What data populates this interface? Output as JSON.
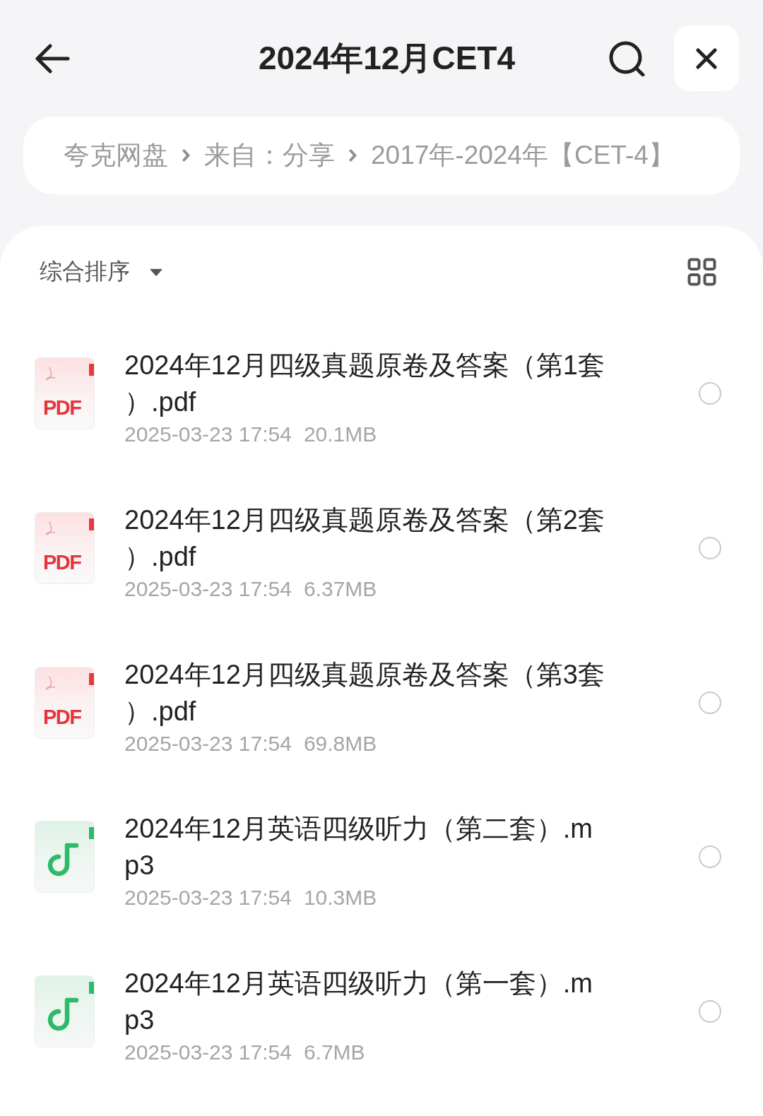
{
  "header": {
    "title": "2024年12月CET4"
  },
  "breadcrumb": [
    "夸克网盘",
    "来自：分享",
    "2017年-2024年【CET-4】"
  ],
  "sort": {
    "label": "综合排序"
  },
  "files": [
    {
      "kind": "pdf",
      "icon_label": "PDF",
      "name": "2024年12月四级真题原卷及答案（第1套）.pdf",
      "date": "2025-03-23 17:54",
      "size": "20.1MB",
      "selected": false
    },
    {
      "kind": "pdf",
      "icon_label": "PDF",
      "name": "2024年12月四级真题原卷及答案（第2套）.pdf",
      "date": "2025-03-23 17:54",
      "size": "6.37MB",
      "selected": false
    },
    {
      "kind": "pdf",
      "icon_label": "PDF",
      "name": "2024年12月四级真题原卷及答案（第3套）.pdf",
      "date": "2025-03-23 17:54",
      "size": "69.8MB",
      "selected": false
    },
    {
      "kind": "audio",
      "name": "2024年12月英语四级听力（第二套）.mp3",
      "date": "2025-03-23 17:54",
      "size": "10.3MB",
      "selected": false
    },
    {
      "kind": "audio",
      "name": "2024年12月英语四级听力（第一套）.mp3",
      "date": "2025-03-23 17:54",
      "size": "6.7MB",
      "selected": false
    }
  ]
}
